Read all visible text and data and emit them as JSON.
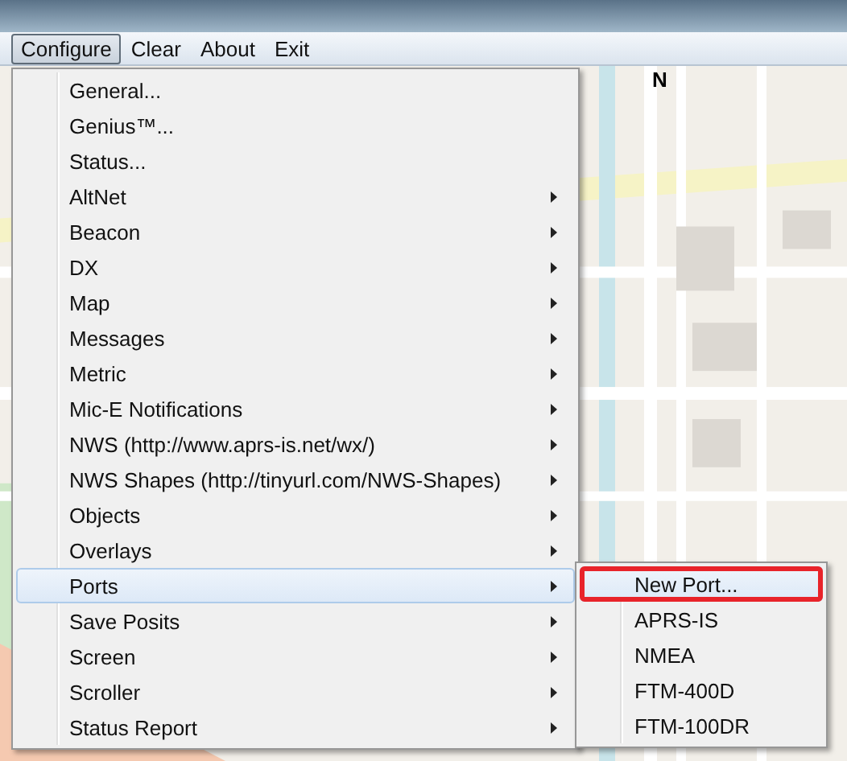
{
  "menubar": [
    {
      "label": "Configure",
      "selected": true
    },
    {
      "label": "Clear",
      "selected": false
    },
    {
      "label": "About",
      "selected": false
    },
    {
      "label": "Exit",
      "selected": false
    }
  ],
  "map": {
    "kind": "picture",
    "north_label": "N"
  },
  "menu": {
    "items": [
      {
        "label": "General...",
        "submenu": false,
        "selected": false
      },
      {
        "label": "Genius™...",
        "submenu": false,
        "selected": false
      },
      {
        "label": "Status...",
        "submenu": false,
        "selected": false
      },
      {
        "label": "AltNet",
        "submenu": true,
        "selected": false
      },
      {
        "label": "Beacon",
        "submenu": true,
        "selected": false
      },
      {
        "label": "DX",
        "submenu": true,
        "selected": false
      },
      {
        "label": "Map",
        "submenu": true,
        "selected": false
      },
      {
        "label": "Messages",
        "submenu": true,
        "selected": false
      },
      {
        "label": "Metric",
        "submenu": true,
        "selected": false
      },
      {
        "label": "Mic-E Notifications",
        "submenu": true,
        "selected": false
      },
      {
        "label": "NWS (http://www.aprs-is.net/wx/)",
        "submenu": true,
        "selected": false
      },
      {
        "label": "NWS Shapes (http://tinyurl.com/NWS-Shapes)",
        "submenu": true,
        "selected": false
      },
      {
        "label": "Objects",
        "submenu": true,
        "selected": false
      },
      {
        "label": "Overlays",
        "submenu": true,
        "selected": false
      },
      {
        "label": "Ports",
        "submenu": true,
        "selected": true
      },
      {
        "label": "Save Posits",
        "submenu": true,
        "selected": false
      },
      {
        "label": "Screen",
        "submenu": true,
        "selected": false
      },
      {
        "label": "Scroller",
        "submenu": true,
        "selected": false
      },
      {
        "label": "Status Report",
        "submenu": true,
        "selected": false
      }
    ]
  },
  "submenu": {
    "items": [
      {
        "label": "New Port...",
        "selected": true,
        "outlined": true
      },
      {
        "label": "APRS-IS",
        "selected": false,
        "outlined": false
      },
      {
        "label": "NMEA",
        "selected": false,
        "outlined": false
      },
      {
        "label": "FTM-400D",
        "selected": false,
        "outlined": false
      },
      {
        "label": "FTM-100DR",
        "selected": false,
        "outlined": false
      }
    ]
  }
}
